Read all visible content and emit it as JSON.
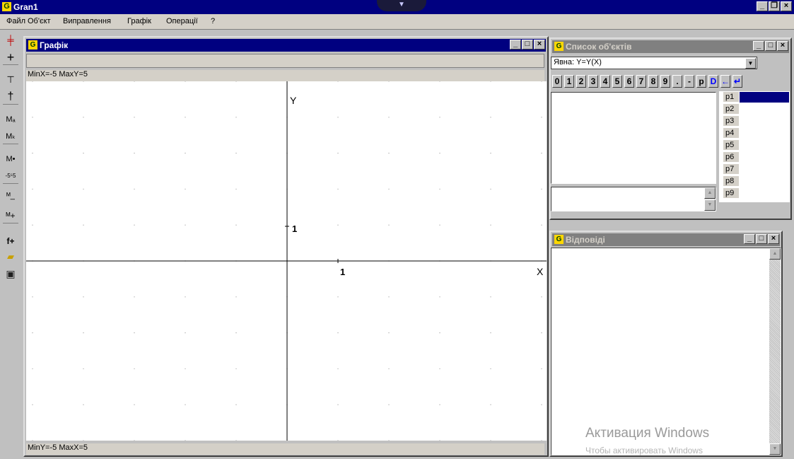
{
  "app": {
    "title": "Gran1",
    "icon": "gran-app-icon",
    "window_controls": [
      "_",
      "▫",
      "×"
    ]
  },
  "menu": [
    {
      "label": "Файл"
    },
    {
      "label": "Об'єкт"
    },
    {
      "label": "Виправлення"
    },
    {
      "label": "Графік"
    },
    {
      "label": "Операції"
    },
    {
      "label": "?"
    }
  ],
  "toolbar": {
    "tools": [
      {
        "icon": "axes-red-icon",
        "glyph": "┼"
      },
      {
        "icon": "cross-icon",
        "glyph": "+"
      },
      {
        "icon": "vertical-shift-icon",
        "glyph": "⊤"
      },
      {
        "icon": "tilted-cross-icon",
        "glyph": "✝"
      },
      {
        "icon": "Ma",
        "glyph": "Ma"
      },
      {
        "icon": "Mk",
        "glyph": "Mк"
      },
      {
        "icon": "M-dot",
        "glyph": "M•"
      },
      {
        "icon": "scale-icon",
        "glyph": "-5⁵5"
      },
      {
        "icon": "M-minus",
        "glyph": "ᴹ−"
      },
      {
        "icon": "M-plus",
        "glyph": "ᴹ+"
      },
      {
        "icon": "f-plus",
        "glyph": "f+"
      },
      {
        "icon": "open-folder-icon",
        "glyph": "📂"
      },
      {
        "icon": "save-floppy-icon",
        "glyph": "💾"
      }
    ]
  },
  "graph_window": {
    "title": "Графік",
    "top_status": "MinX=-5  MaxY=5",
    "bottom_status": "MinY=-5  MaxX=5",
    "axis_x_label": "X",
    "axis_y_label": "Y",
    "tick_x_label": "1",
    "tick_y_label": "1"
  },
  "objects_window": {
    "title": "Список об'єктів",
    "combo_value": "Явна: Y=Y(X)",
    "keypad": [
      "0",
      "1",
      "2",
      "3",
      "4",
      "5",
      "6",
      "7",
      "8",
      "9",
      ".",
      "-",
      "p",
      "D",
      "←",
      "↵"
    ],
    "params": [
      "p1",
      "p2",
      "p3",
      "p4",
      "p5",
      "p6",
      "p7",
      "p8",
      "p9"
    ]
  },
  "answers_window": {
    "title": "Відповіді"
  },
  "watermark": {
    "line1": "Активация Windows",
    "line2": "Чтобы активировать Windows"
  },
  "colors": {
    "title_active": "#000080",
    "title_inactive": "#808080",
    "face": "#c0c0c0",
    "keypad_blue": "#0000ff"
  }
}
